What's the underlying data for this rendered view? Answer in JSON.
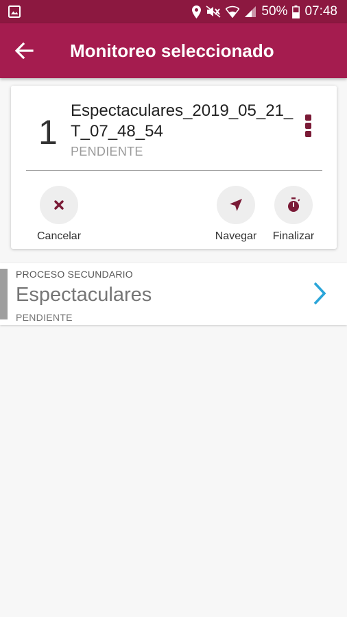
{
  "status_bar": {
    "battery": "50%",
    "time": "07:48",
    "icons": [
      "gallery-icon",
      "location-icon",
      "mute-icon",
      "wifi-icon",
      "signal-icon",
      "battery-icon"
    ]
  },
  "app_bar": {
    "title": "Monitoreo seleccionado",
    "back_icon": "arrow-back-icon"
  },
  "monitor_card": {
    "number": "1",
    "name": "Espectaculares_2019_05_21_T_07_48_54",
    "state": "PENDIENTE",
    "menu_icon": "more-vertical-icon",
    "actions": [
      {
        "label": "Cancelar",
        "icon": "close-icon"
      },
      {
        "label": "Navegar",
        "icon": "navigation-icon"
      },
      {
        "label": "Finalizar",
        "icon": "stopwatch-icon"
      }
    ]
  },
  "sub_process": {
    "caption": "PROCESO SECUNDARIO",
    "title": "Espectaculares",
    "state": "PENDIENTE",
    "chevron_icon": "chevron-right-icon"
  },
  "colors": {
    "status_bar": "#8c1840",
    "app_bar": "#a51c4f",
    "accent_dark": "#7a1a36",
    "chevron": "#2aa5d9"
  }
}
